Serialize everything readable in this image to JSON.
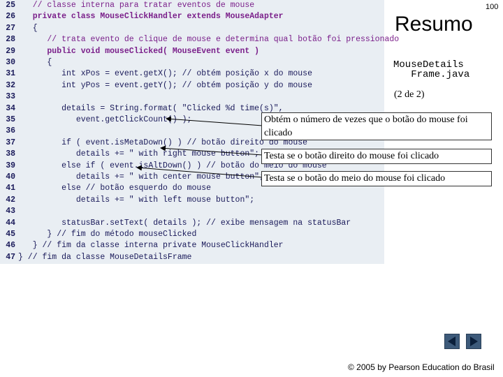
{
  "page_number": "100",
  "title": "Resumo",
  "file_name": "MouseDetails\n   Frame.java",
  "part": "(2 de 2)",
  "code_lines": [
    {
      "n": "25",
      "t": "   // classe interna para tratar eventos de mouse",
      "cls": "comment"
    },
    {
      "n": "26",
      "t": "   private class MouseClickHandler extends MouseAdapter",
      "cls": "kw"
    },
    {
      "n": "27",
      "t": "   {",
      "cls": ""
    },
    {
      "n": "28",
      "t": "      // trata evento de clique de mouse e determina qual botão foi pressionado",
      "cls": "comment"
    },
    {
      "n": "29",
      "t": "      public void mouseClicked( MouseEvent event )",
      "cls": "kw"
    },
    {
      "n": "30",
      "t": "      {",
      "cls": ""
    },
    {
      "n": "31",
      "t": "         int xPos = event.getX(); // obtém posição x do mouse",
      "cls": ""
    },
    {
      "n": "32",
      "t": "         int yPos = event.getY(); // obtém posição y do mouse",
      "cls": ""
    },
    {
      "n": "33",
      "t": "",
      "cls": ""
    },
    {
      "n": "34",
      "t": "         details = String.format( \"Clicked %d time(s)\",",
      "cls": ""
    },
    {
      "n": "35",
      "t": "            event.getClickCount() );",
      "cls": ""
    },
    {
      "n": "36",
      "t": "",
      "cls": ""
    },
    {
      "n": "37",
      "t": "         if ( event.isMetaDown() ) // botão direito do mouse",
      "cls": ""
    },
    {
      "n": "38",
      "t": "            details += \" with right mouse button\";",
      "cls": ""
    },
    {
      "n": "39",
      "t": "         else if ( event.isAltDown() ) // botão do meio do mouse",
      "cls": ""
    },
    {
      "n": "40",
      "t": "            details += \" with center mouse button\";",
      "cls": ""
    },
    {
      "n": "41",
      "t": "         else // botão esquerdo do mouse",
      "cls": ""
    },
    {
      "n": "42",
      "t": "            details += \" with left mouse button\";",
      "cls": ""
    },
    {
      "n": "43",
      "t": "",
      "cls": ""
    },
    {
      "n": "44",
      "t": "         statusBar.setText( details ); // exibe mensagem na statusBar",
      "cls": ""
    },
    {
      "n": "45",
      "t": "      } // fim do método mouseClicked",
      "cls": ""
    },
    {
      "n": "46",
      "t": "   } // fim da classe interna private MouseClickHandler",
      "cls": ""
    },
    {
      "n": "47",
      "t": "} // fim da classe MouseDetailsFrame",
      "cls": ""
    }
  ],
  "callouts": [
    {
      "text": "Obtém o número de vezes que o botão do mouse foi clicado"
    },
    {
      "text": "Testa se o botão direito do mouse foi clicado"
    },
    {
      "text": "Testa se o botão do meio do mouse foi clicado"
    }
  ],
  "footer": "© 2005 by Pearson Education do Brasil",
  "icons": {
    "prev": "prev-slide-icon",
    "next": "next-slide-icon"
  },
  "colors": {
    "code_background": "#e9eef3",
    "comment": "#7a1f8a",
    "nav_button": "#3d5a7a"
  }
}
